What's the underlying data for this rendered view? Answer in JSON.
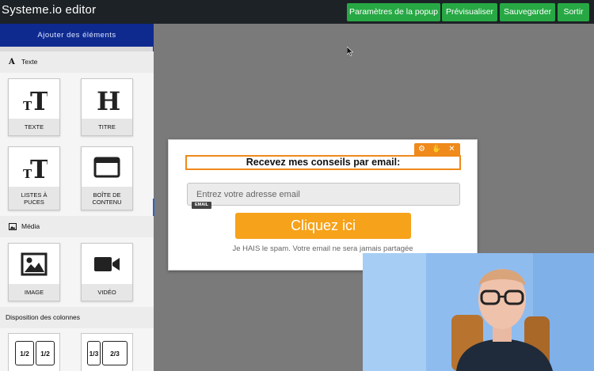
{
  "app": {
    "title": "Systeme.io editor"
  },
  "toolbar": {
    "buttons": [
      {
        "label": "Paramètres de la popup"
      },
      {
        "label": "Prévisualiser"
      },
      {
        "label": "Sauvegarder"
      },
      {
        "label": "Sortir"
      }
    ]
  },
  "sidebar": {
    "header": "Ajouter des éléments",
    "sections": [
      {
        "label": "Texte",
        "icon": "text-icon",
        "items": [
          {
            "label": "TEXTE",
            "icon": "text-size-icon"
          },
          {
            "label": "TITRE",
            "icon": "heading-icon"
          },
          {
            "label": "LISTES À PUCES",
            "icon": "list-text-icon"
          },
          {
            "label": "BOÎTE DE CONTENU",
            "icon": "content-box-icon"
          }
        ]
      },
      {
        "label": "Média",
        "icon": "image-icon",
        "items": [
          {
            "label": "IMAGE",
            "icon": "image-icon"
          },
          {
            "label": "VIDÉO",
            "icon": "video-camera-icon"
          }
        ]
      },
      {
        "label": "Disposition des colonnes",
        "items": [
          {
            "columns": [
              "1/2",
              "1/2"
            ]
          },
          {
            "columns": [
              "1/3",
              "2/3"
            ]
          }
        ]
      }
    ]
  },
  "popup": {
    "headline": "Recevez mes conseils par email:",
    "email_placeholder": "Entrez votre adresse email",
    "email_tag": "EMAIL",
    "cta_label": "Cliquez ici",
    "disclaimer": "Je HAIS le spam. Votre email ne sera jamais partagée",
    "tools": [
      "gear-icon",
      "move-icon",
      "close-icon"
    ],
    "accent": "#ef8a1b",
    "cta_color": "#f6a21a"
  },
  "colors": {
    "topbar": "#1d2226",
    "button": "#27a844",
    "sidebar_header": "#0f2a8f",
    "canvas": "#7a7a7a"
  }
}
